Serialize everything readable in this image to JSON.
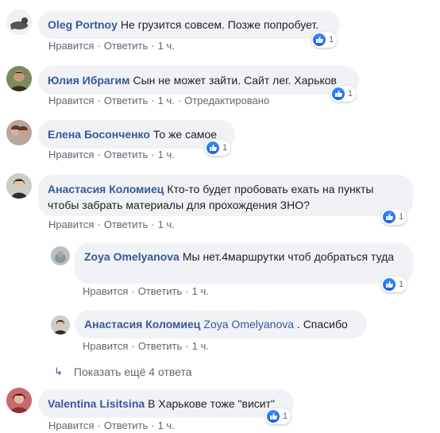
{
  "colors": {
    "link": "#385898",
    "meta": "#606770",
    "bubble": "#f0f2f5",
    "like": "#1877f2"
  },
  "actions": {
    "like": "Нравится",
    "reply": "Ответить",
    "edited": "Отредактировано"
  },
  "comments": [
    {
      "author": "Oleg Portnoy",
      "text": "Не грузится совсем. Позже попробует.",
      "time": "1 ч.",
      "likes": "1"
    },
    {
      "author": "Юлия Ибрагим",
      "text": "Сын не может зайти. Сайт лег. Харьков",
      "time": "1 ч.",
      "likes": "1",
      "edited": true
    },
    {
      "author": "Елена Босонченко",
      "text": "То же самое",
      "time": "1 ч.",
      "likes": "1"
    },
    {
      "author": "Анастасия Коломиец",
      "text": "Кто-то будет пробовать ехать на пункты чтобы забрать материалы для прохождения ЗНО?",
      "time": "1 ч.",
      "likes": "1"
    },
    {
      "author": "Zoya Omelyanova",
      "text": "Мы нет.4маршрутки чтоб добраться туда",
      "time": "1 ч.",
      "likes": "1"
    },
    {
      "author": "Анастасия Коломиец",
      "mention": "Zoya Omelyanova",
      "text": ". Спасибо",
      "time": "1 ч."
    },
    {
      "author": "Valentina Lisitsina",
      "text": "В Харькове тоже \"висит\"",
      "time": "1 ч.",
      "likes": "1"
    }
  ],
  "more_replies": "Показать ещё 4 ответа",
  "icons": {
    "more_arrow": "reply-arrow-icon",
    "like": "thumbs-up-icon"
  }
}
